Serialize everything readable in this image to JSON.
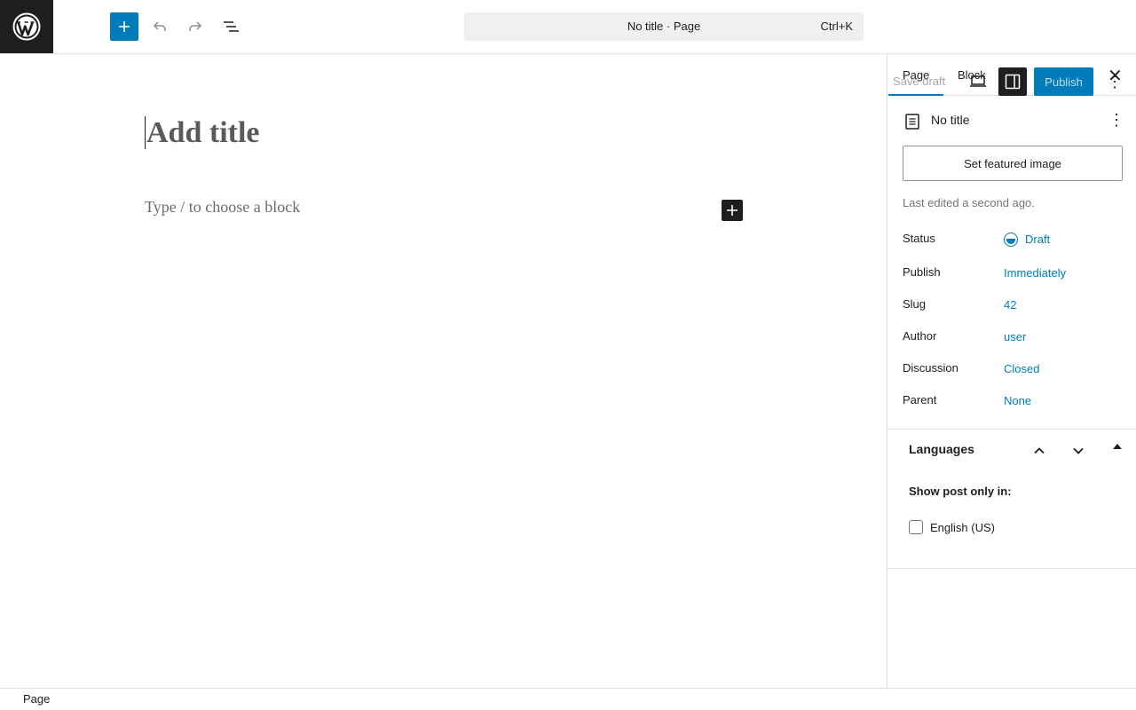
{
  "header": {
    "command_bar_title": "No title · Page",
    "command_bar_shortcut": "Ctrl+K",
    "save_draft_label": "Save draft",
    "publish_label": "Publish",
    "more_label": "⋮"
  },
  "editor": {
    "title_placeholder": "Add title",
    "block_placeholder": "Type / to choose a block"
  },
  "sidebar": {
    "tabs": [
      {
        "label": "Page"
      },
      {
        "label": "Block"
      }
    ],
    "close_label": "✕",
    "document_name": "No title",
    "more_label": "⋮",
    "featured_image_label": "Set featured image",
    "last_edited": "Last edited a second ago.",
    "properties": [
      {
        "label": "Status",
        "value": "Draft"
      },
      {
        "label": "Publish",
        "value": "Immediately"
      },
      {
        "label": "Slug",
        "value": "42"
      },
      {
        "label": "Author",
        "value": "user"
      },
      {
        "label": "Discussion",
        "value": "Closed"
      },
      {
        "label": "Parent",
        "value": "None"
      }
    ],
    "languages": {
      "title": "Languages",
      "show_label": "Show post only in:",
      "options": [
        {
          "label": "English (US)",
          "checked": false
        }
      ]
    }
  },
  "footer": {
    "breadcrumb": "Page"
  },
  "colors": {
    "accent": "#007cba",
    "dark": "#1e1e1e",
    "border": "#e0e0e0"
  }
}
